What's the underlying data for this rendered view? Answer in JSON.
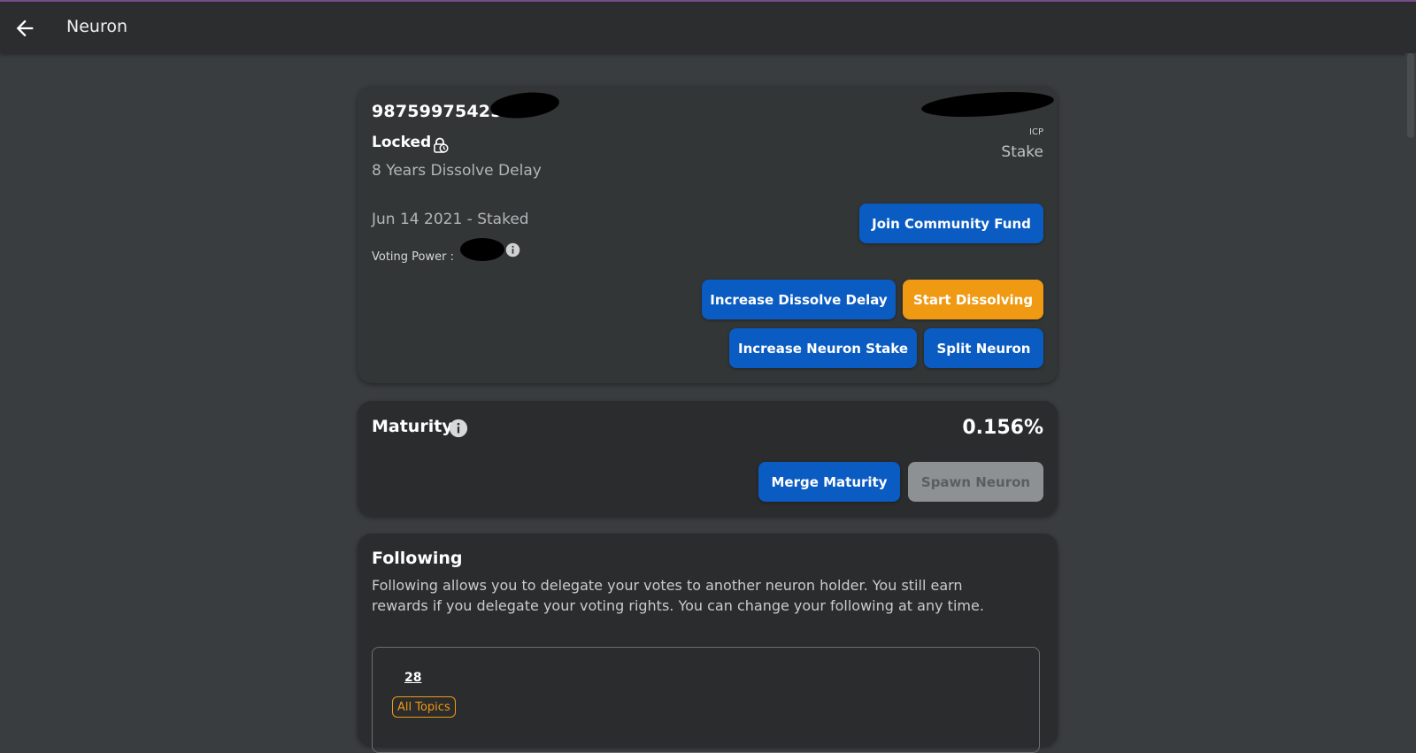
{
  "app": {
    "title": "Neuron"
  },
  "neuron": {
    "id": "987599754250",
    "state": "Locked",
    "dissolve_delay": "8 Years Dissolve Delay",
    "staked_date": "Jun 14 2021 - Staked",
    "voting_power_label": "Voting Power :",
    "stake_unit": "ICP",
    "stake_label": "Stake",
    "buttons": {
      "join_community_fund": "Join Community Fund",
      "increase_dissolve_delay": "Increase Dissolve Delay",
      "start_dissolving": "Start Dissolving",
      "increase_neuron_stake": "Increase Neuron Stake",
      "split_neuron": "Split Neuron"
    }
  },
  "maturity": {
    "title": "Maturity",
    "value": "0.156%",
    "buttons": {
      "merge_maturity": "Merge Maturity",
      "spawn_neuron": "Spawn Neuron"
    }
  },
  "following": {
    "title": "Following",
    "description": "Following allows you to delegate your votes to another neuron holder. You still earn rewards if you delegate your voting rights. You can change your following at any time.",
    "count": "28",
    "topic": "All Topics"
  },
  "colors": {
    "primary_button": "#0a5bc2",
    "warning_button": "#ef9a12",
    "disabled_button": "#8e9193",
    "card_bg": "#2d2f30",
    "page_bg": "#3a3d3f"
  },
  "icons": {
    "back": "arrow-left-icon",
    "lock": "lock-clock-icon",
    "info": "info-icon"
  }
}
